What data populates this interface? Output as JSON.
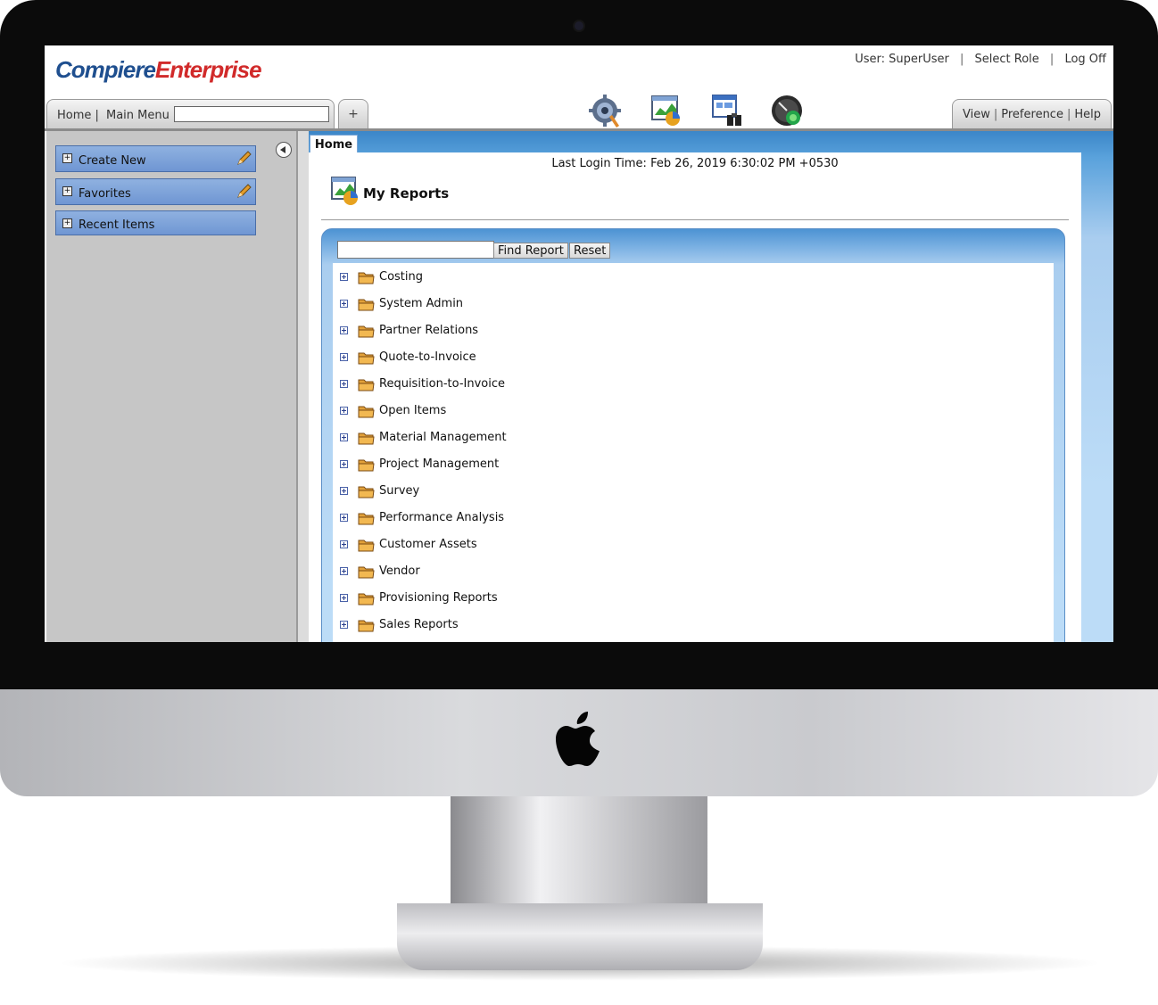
{
  "app": {
    "logo_part1": "Compiere",
    "logo_part2": "Enterprise"
  },
  "user_bar": {
    "user": "User: SuperUser",
    "select_role": "Select Role",
    "log_off": "Log Off",
    "separator": "|"
  },
  "left_tabs": {
    "home": "Home |",
    "main_menu": "Main Menu",
    "search_value": "",
    "add_tab": "+"
  },
  "toolbar_icons": [
    "settings-icon",
    "reports-icon",
    "search-window-icon",
    "dashboard-icon"
  ],
  "right_tabs": {
    "view": "View",
    "preference": "Preference",
    "help": "Help",
    "separator": "|"
  },
  "sidebar": {
    "items": [
      {
        "label": "Create New",
        "icon": "pencil-icon"
      },
      {
        "label": "Favorites",
        "icon": "pencil-icon"
      },
      {
        "label": "Recent Items"
      }
    ]
  },
  "main": {
    "tab": "Home",
    "last_login": "Last Login Time: Feb 26, 2019 6:30:02 PM +0530",
    "section_title": "My Reports",
    "search_value": "",
    "find_button": "Find Report",
    "reset_button": "Reset",
    "report_folders": [
      "Costing",
      "System Admin",
      "Partner Relations",
      "Quote-to-Invoice",
      "Requisition-to-Invoice",
      "Open Items",
      "Material Management",
      "Project Management",
      "Survey",
      "Performance Analysis",
      "Customer Assets",
      "Vendor",
      "Provisioning Reports",
      "Sales Reports"
    ]
  },
  "colors": {
    "accent_blue": "#3b86c8",
    "sidebar_item": "#7aa0d8",
    "logo_blue": "#1f4f8f",
    "logo_red": "#d12a2a"
  }
}
